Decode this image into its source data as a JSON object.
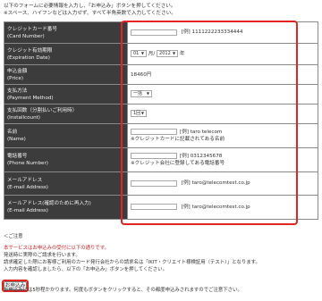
{
  "intro": {
    "line1": "以下のフォームに必要情報を入力し、「お申込み」ボタンを押してください。",
    "line2": "※スペース、ハイフンなどは入力せず、すべて半角英数で入力してください。"
  },
  "form": {
    "card_number": {
      "label": "クレジットカード番号",
      "label_en": "(Card Number)",
      "value": "",
      "hint": "[例] 1111222233334444"
    },
    "expiration": {
      "label": "クレジット有効期限",
      "label_en": "(Expiration Date)",
      "month": "01",
      "month_unit": "月/",
      "year": "2012",
      "year_unit": "年"
    },
    "price": {
      "label": "申込金額",
      "label_en": "(Price)",
      "value": "18460円"
    },
    "payment_method": {
      "label": "支払方法",
      "label_en": "(Payment Method)",
      "selected": "一括"
    },
    "installment": {
      "label": "支払回数（分割払いご利用時）",
      "label_en": "(Installcount)",
      "selected": "1回"
    },
    "name": {
      "label": "名前",
      "label_en": "(Name)",
      "value": "",
      "hint": "[例] taro telecom",
      "note": "※クレジットカードに記載されてある名前"
    },
    "phone": {
      "label": "電話番号",
      "label_en": "(Phone Number)",
      "value": "",
      "hint": "[例] 0312345678",
      "note": "※クレジット会社に登録してある電話番号"
    },
    "email": {
      "label": "メールアドレス",
      "label_en": "(E-mail Address)",
      "value": "",
      "hint": "[例] taro@telecomtest.co.jp"
    },
    "email_confirm": {
      "label": "メールアドレス(確認のために再入力)",
      "label_en": "(E-mail Address)",
      "value": "",
      "hint": "[例] taro@telecomtest.co.jp"
    }
  },
  "notes": {
    "title": "＜ご注意",
    "warning": "本サービスはお申込みの受付に以下の通りです。",
    "line1": "発送時に実際のご請求を行います。",
    "line2": "請求確定した際にお客様ご利用のカード発行会社からの請求名は「IKIT・クリエイト様検証用（テスト）」となります。",
    "line3": "入力内容を確認しましたら、以下の「お申込み」ボタンを押してください。",
    "bottom": "お申込みには5秒程かかります。何度もボタンをクリックすると、その都度申込みされますのでご注意下さい。"
  },
  "submit_label": "お申込み",
  "colors": {
    "label_bg": "#3c3c3c",
    "highlight": "#e12424",
    "warning_text": "#d02020"
  }
}
